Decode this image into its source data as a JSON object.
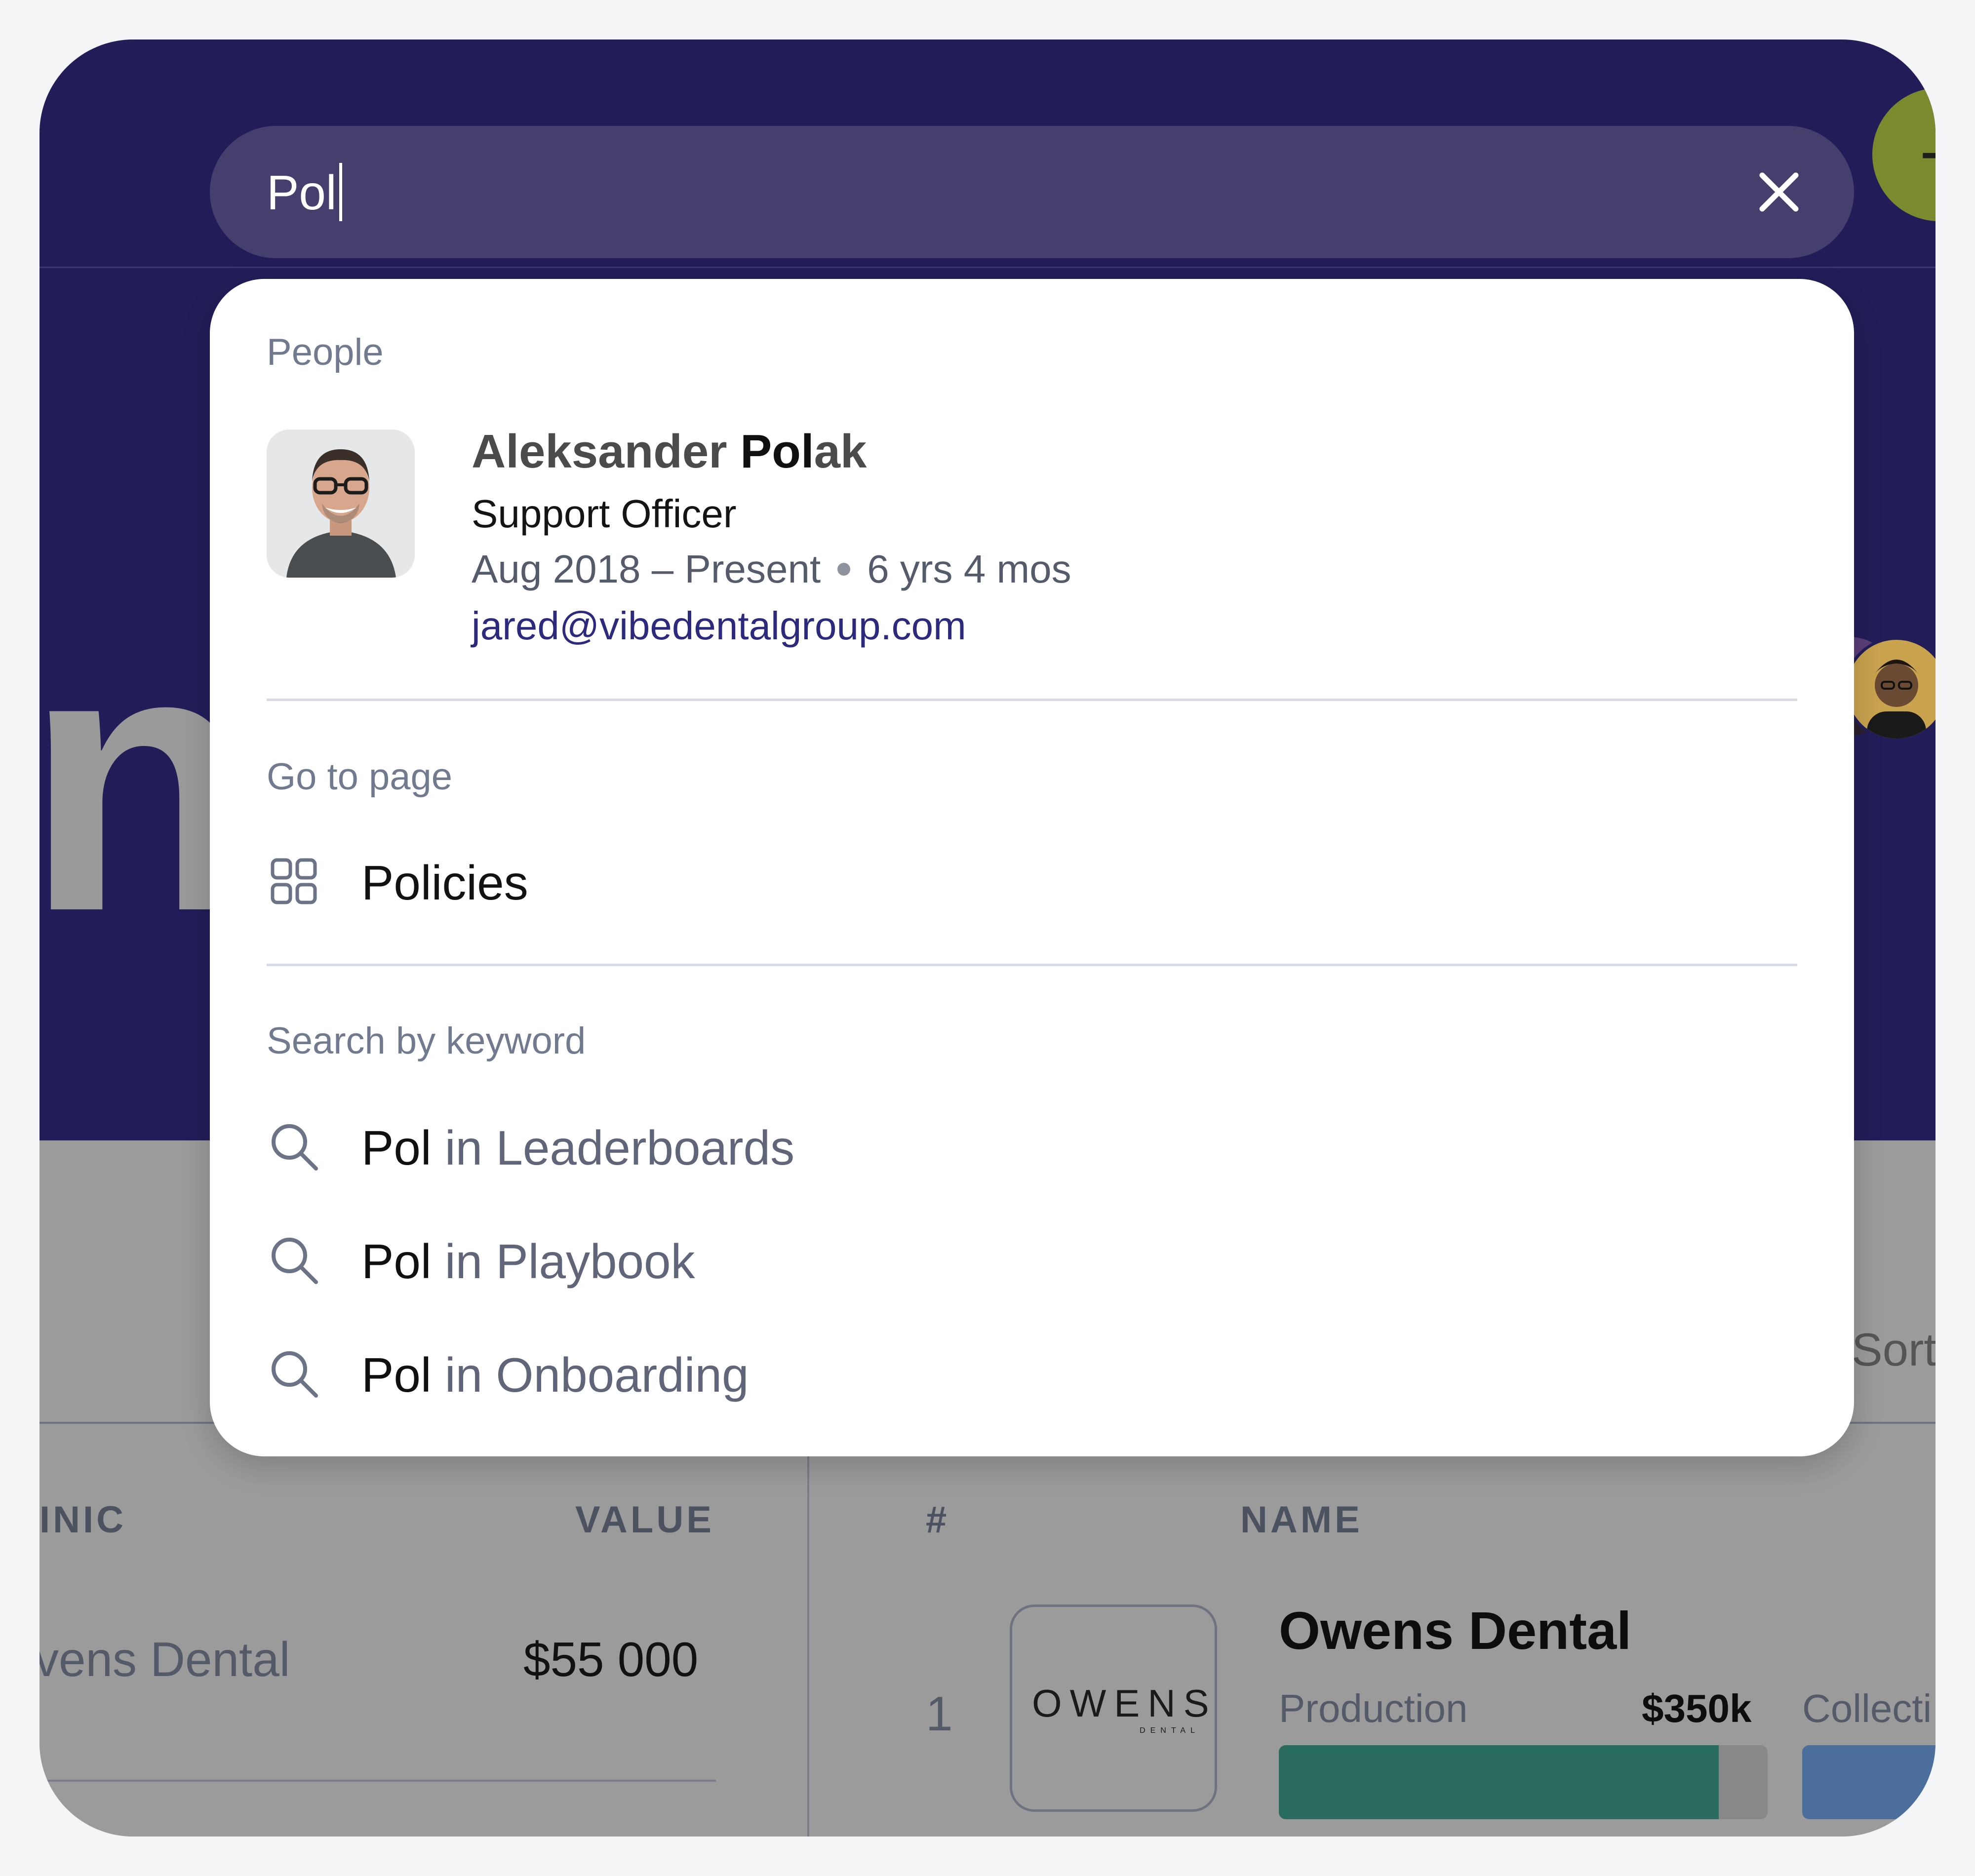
{
  "search": {
    "value": "Pol"
  },
  "dropdown": {
    "people_title": "People",
    "person": {
      "name_pre": "Aleksander ",
      "name_match": "Pol",
      "name_post": "ak",
      "role": "Support Officer",
      "dates": "Aug 2018 – Present",
      "duration": "6 yrs 4 mos",
      "email": "jared@vibedentalgroup.com"
    },
    "goto_title": "Go to page",
    "pages": [
      {
        "label": "Policies",
        "icon": "grid-icon"
      }
    ],
    "keyword_title": "Search by keyword",
    "keyword_items": [
      {
        "keyword": "Pol",
        "rest": " in Leaderboards",
        "icon": "search-icon"
      },
      {
        "keyword": "Pol",
        "rest": " in Playbook",
        "icon": "search-icon"
      },
      {
        "keyword": "Pol",
        "rest": " in Onboarding",
        "icon": "search-icon"
      }
    ]
  },
  "background": {
    "big_letter": "n",
    "sort_label": "Sort",
    "left_table": {
      "headers": [
        "INIC",
        "VALUE"
      ],
      "row": {
        "clinic": "vens Dental",
        "value": "$55 000"
      }
    },
    "right_table": {
      "headers": [
        "#",
        "NAME"
      ],
      "row": {
        "rank": "1",
        "logo_text": "OWENS",
        "logo_sub": "DENTAL",
        "name": "Owens Dental",
        "production_label": "Production",
        "production_value": "$350k",
        "production_progress": 0.9,
        "collections_label": "Collecti"
      }
    }
  },
  "colors": {
    "hero": "#221d59",
    "search_bg": "#453f6e",
    "fab": "#7a8a2f",
    "production_bar": "#2a6b5f",
    "collections_bar": "#4c6e9c",
    "email": "#2d2a7e"
  }
}
